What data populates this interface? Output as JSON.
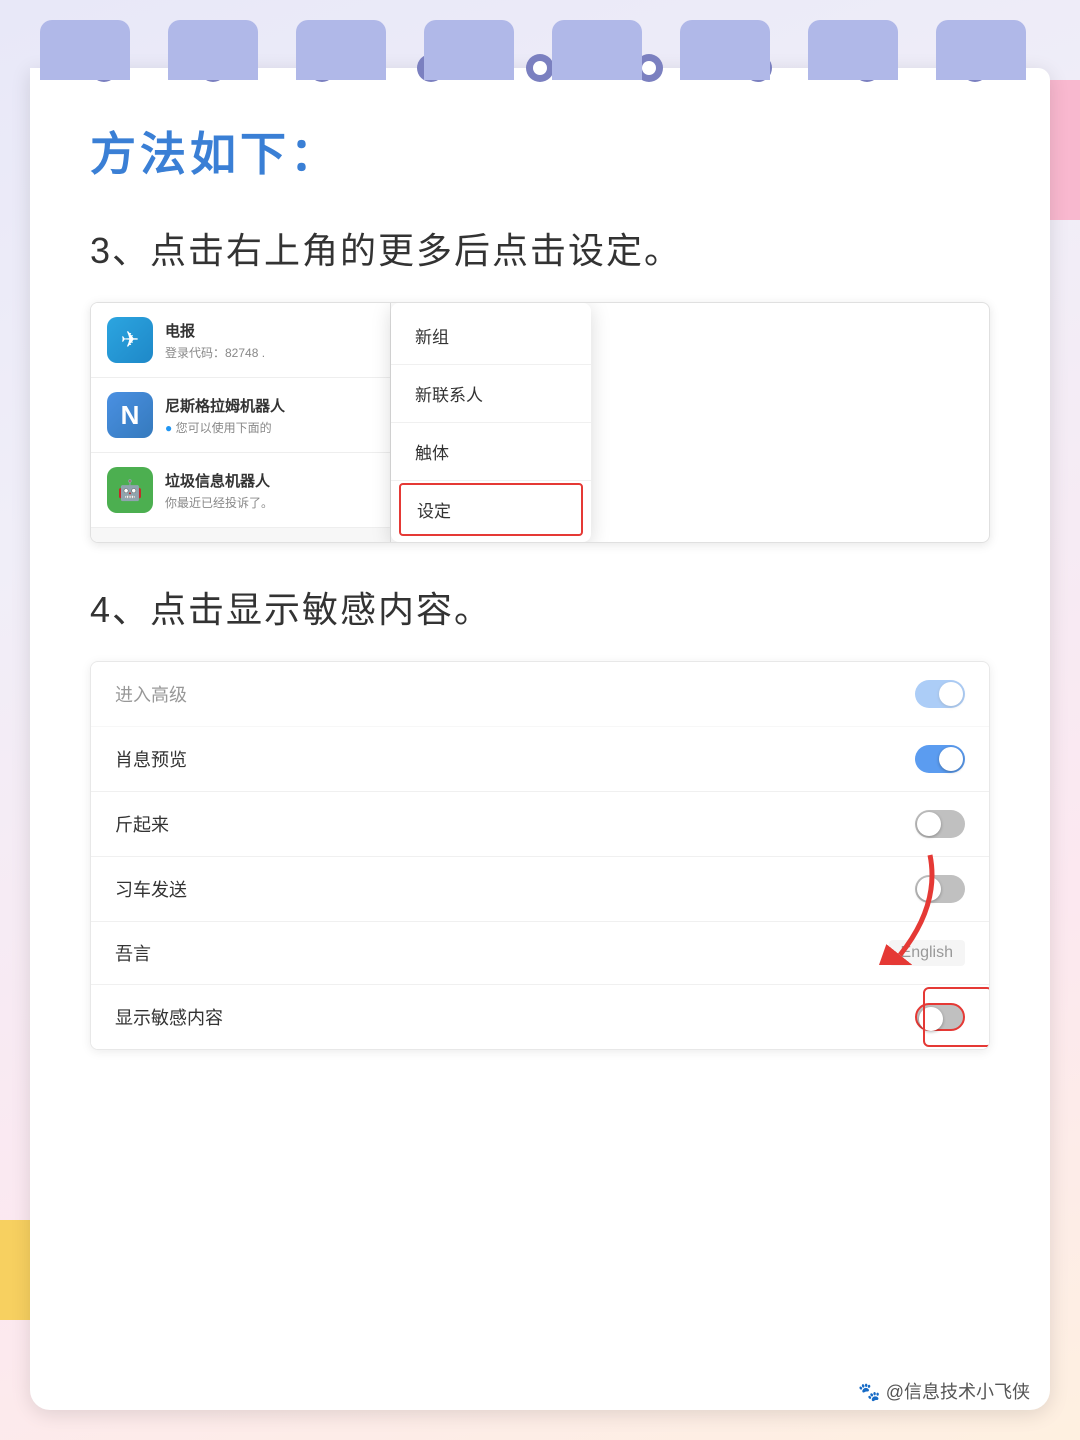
{
  "page": {
    "title": "方法如下：",
    "background_color": "#f0eef8",
    "accent_color": "#3a7fd5"
  },
  "step3": {
    "label": "3、点击右上角的更多后点击设定。",
    "chat_items": [
      {
        "id": "telegram",
        "name": "电报",
        "preview": "登录代码：82748 .",
        "avatar_text": "✈",
        "avatar_type": "telegram"
      },
      {
        "id": "nisi",
        "name": "尼斯格拉姆机器人",
        "preview": "您可以使用下面的",
        "avatar_text": "N",
        "avatar_type": "n",
        "has_dot": true
      },
      {
        "id": "spam",
        "name": "垃圾信息机器人",
        "preview": "你最近已经投诉了。",
        "avatar_text": "🤖",
        "avatar_type": "robot"
      }
    ],
    "menu_items": [
      {
        "id": "new-group",
        "label": "新组",
        "highlighted": false
      },
      {
        "id": "new-contact",
        "label": "新联系人",
        "highlighted": false
      },
      {
        "id": "touch",
        "label": "触体",
        "highlighted": false
      },
      {
        "id": "settings",
        "label": "设定",
        "highlighted": true
      }
    ]
  },
  "step4": {
    "label": "4、点击显示敏感内容。",
    "settings_items": [
      {
        "id": "item-top",
        "label": "进入高级",
        "value_type": "toggle",
        "toggle_on": true,
        "faded": true
      },
      {
        "id": "item-preview",
        "label": "肖息预览",
        "value_type": "toggle",
        "toggle_on": true
      },
      {
        "id": "item-listen",
        "label": "斤起来",
        "value_type": "toggle",
        "toggle_on": false
      },
      {
        "id": "item-send",
        "label": "习车发送",
        "value_type": "toggle",
        "toggle_on": false
      },
      {
        "id": "item-lang",
        "label": "吾言",
        "value_type": "text",
        "value": "English"
      },
      {
        "id": "item-sensitive",
        "label": "显示敏感内容",
        "value_type": "toggle",
        "toggle_on": false,
        "highlighted": true
      }
    ]
  },
  "watermark": {
    "icon": "🐾",
    "text": "@信息技术小飞侠"
  },
  "decorations": {
    "hearts": [
      "❤",
      "❤",
      "❤",
      "❤",
      "❤"
    ],
    "tab_count": 8
  }
}
